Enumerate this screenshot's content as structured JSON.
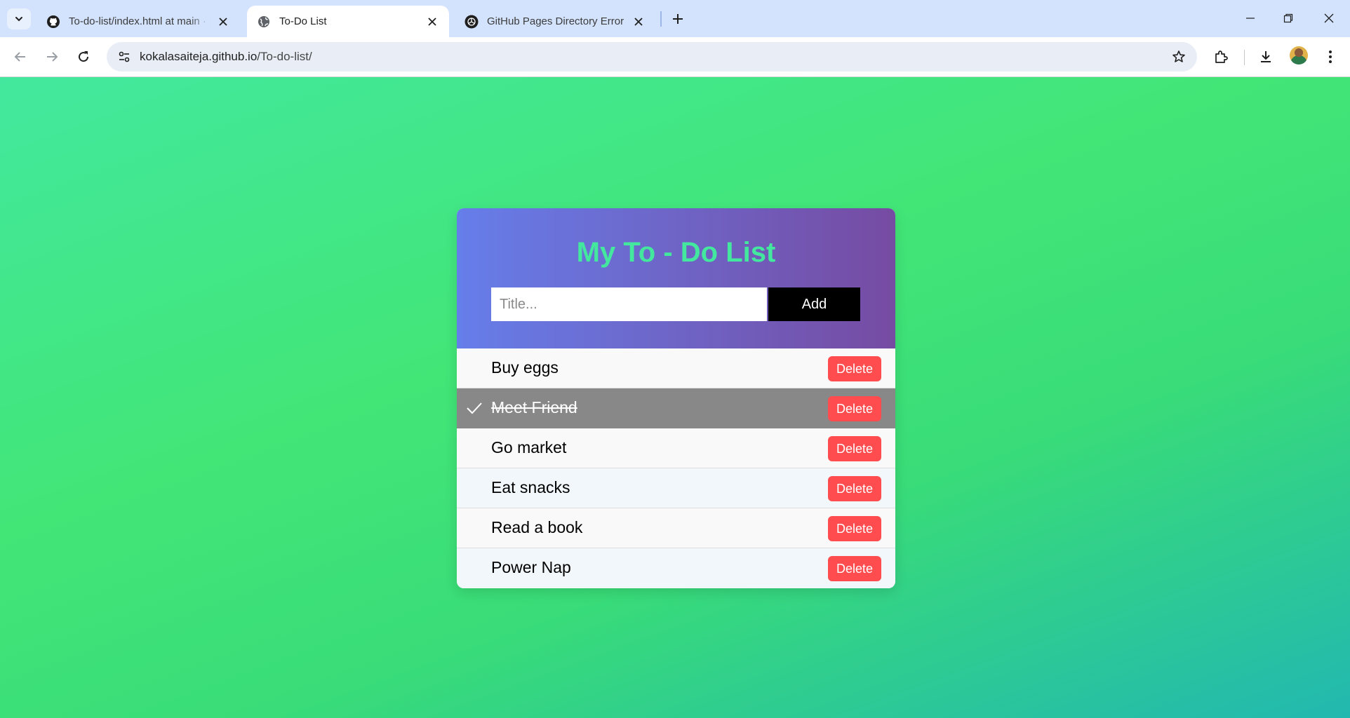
{
  "browser": {
    "tabs": [
      {
        "title": "To-do-list/index.html at main · kokalasaiteja/To-do-list",
        "favicon": "github-icon",
        "active": false
      },
      {
        "title": "To-Do List",
        "favicon": "globe-icon",
        "active": true
      },
      {
        "title": "GitHub Pages Directory Error",
        "favicon": "openai-icon",
        "active": false
      }
    ],
    "url_host": "kokalasaiteja.github.io",
    "url_path": "/To-do-list/"
  },
  "app": {
    "title": "My To - Do List",
    "input_placeholder": "Title...",
    "input_value": "",
    "add_label": "Add",
    "delete_label": "Delete",
    "tasks": [
      {
        "text": "Buy eggs",
        "done": false
      },
      {
        "text": "Meet Friend",
        "done": true
      },
      {
        "text": "Go market",
        "done": false
      },
      {
        "text": "Eat snacks",
        "done": false
      },
      {
        "text": "Read a book",
        "done": false
      },
      {
        "text": "Power Nap",
        "done": false
      }
    ]
  },
  "colors": {
    "page_gradient_start": "#43e89e",
    "page_gradient_end": "#22b8b0",
    "header_gradient_start": "#667eea",
    "header_gradient_end": "#764ba2",
    "title_color": "#43e89e",
    "delete_button": "#ff4d4f",
    "checked_row": "#888888"
  }
}
